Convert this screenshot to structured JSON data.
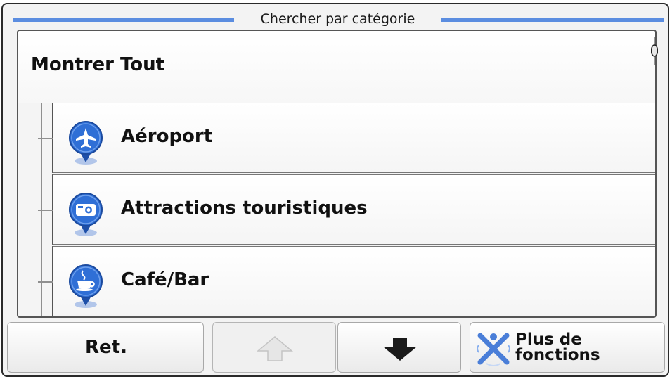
{
  "header": {
    "title": "Chercher par catégorie"
  },
  "list": {
    "show_all_label": "Montrer Tout",
    "categories": [
      {
        "label": "Aéroport",
        "icon": "airport-icon"
      },
      {
        "label": "Attractions touristiques",
        "icon": "camera-icon"
      },
      {
        "label": "Café/Bar",
        "icon": "coffee-cup-icon"
      }
    ]
  },
  "toolbar": {
    "back_label": "Ret.",
    "up_icon": "arrow-up-icon",
    "down_icon": "arrow-down-icon",
    "more_label_line1": "Plus de",
    "more_label_line2": "fonctions"
  },
  "colors": {
    "accent": "#5b8de0",
    "pin": "#2f6fd6"
  }
}
